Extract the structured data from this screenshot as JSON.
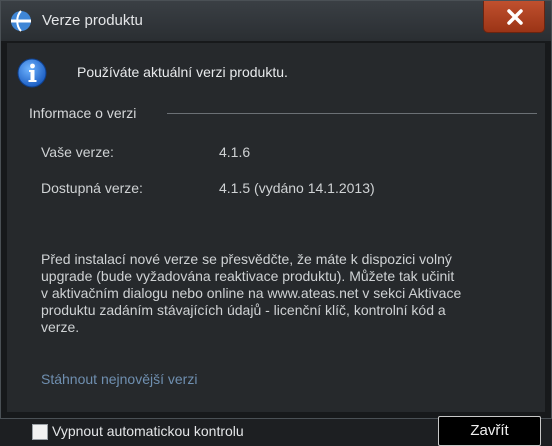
{
  "window": {
    "title": "Verze produktu",
    "app_icon": "app-logo-icon",
    "close_icon": "close-icon"
  },
  "info": {
    "icon": "info-icon",
    "message": "Používáte aktuální verzi produktu."
  },
  "section": {
    "title": "Informace o verzi",
    "rows": [
      {
        "label": "Vaše verze:",
        "value": "4.1.6"
      },
      {
        "label": "Dostupná verze:",
        "value": "4.1.5 (vydáno 14.1.2013)"
      }
    ]
  },
  "description": [
    "Před instalací nové verze se přesvědčte, že máte k dispozici volný",
    "upgrade (bude vyžadována reaktivace produktu). Můžete tak učinit",
    "v aktivačním dialogu nebo online na www.ateas.net v sekci Aktivace",
    "produktu zadáním stávajících údajů - licenční klíč, kontrolní kód a",
    "verze."
  ],
  "download_link": "Stáhnout nejnovější verzi",
  "auto_check": {
    "label": "Vypnout automatickou kontrolu",
    "checked": false
  },
  "close_button": "Zavřít",
  "colors": {
    "titlebar": "#2f3337",
    "close_button": "#b4421f",
    "body": "#26292c",
    "link": "#6f8fb0",
    "text": "#cfd2d4"
  }
}
